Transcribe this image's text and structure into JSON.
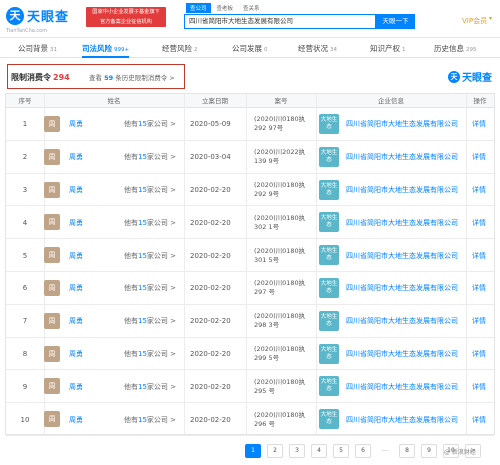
{
  "header": {
    "logo_mark": "天",
    "logo_name": "天眼查",
    "logo_sub": "TianYanCha.com",
    "badge_line1": "国家中小企业发展子基金旗下",
    "badge_line2": "官方备案企业征信机构",
    "search_tabs": [
      "查公司",
      "查老板",
      "查关系"
    ],
    "search_value": "四川省简阳市大地生态发展有限公司",
    "search_button": "天眼一下",
    "vip_label": "VIP会员",
    "accent_color": "#0084ff",
    "badge_color": "#e23b3b"
  },
  "nav": {
    "tabs": [
      {
        "label": "公司背景",
        "count": "31"
      },
      {
        "label": "司法风险",
        "count": "999+"
      },
      {
        "label": "经营风险",
        "count": "2"
      },
      {
        "label": "公司发展",
        "count": "0"
      },
      {
        "label": "经营状况",
        "count": "34"
      },
      {
        "label": "知识产权",
        "count": "1"
      },
      {
        "label": "历史信息",
        "count": "295"
      }
    ],
    "active_tab": "司法风险"
  },
  "section": {
    "title": "限制消费令",
    "count": "294",
    "history_text_prefix": "查看",
    "history_count": "59",
    "history_text_suffix": "条历史限制消费令 >",
    "watermark_mark": "天",
    "watermark_name": "天眼查"
  },
  "table": {
    "headers": [
      "序号",
      "姓名",
      "立案日期",
      "案号",
      "企业信息",
      "操作"
    ],
    "rows": [
      {
        "idx": "1",
        "avatar": "周",
        "name": "周勇",
        "own_prefix": "他有",
        "own_count": "15",
        "own_suffix": "家公司 >",
        "date": "2020-05-09",
        "case": "(2020)川0180执292 97号",
        "company_avatar": "大地生态",
        "company": "四川省简阳市大地生态发展有限公司",
        "action": "详情"
      },
      {
        "idx": "2",
        "avatar": "周",
        "name": "周勇",
        "own_prefix": "他有",
        "own_count": "15",
        "own_suffix": "家公司 >",
        "date": "2020-03-04",
        "case": "(2020)川2022执139 9号",
        "company_avatar": "大地生态",
        "company": "四川省简阳市大地生态发展有限公司",
        "action": "详情"
      },
      {
        "idx": "3",
        "avatar": "周",
        "name": "周勇",
        "own_prefix": "他有",
        "own_count": "15",
        "own_suffix": "家公司 >",
        "date": "2020-02-20",
        "case": "(2020)川0180执292 9号",
        "company_avatar": "大地生态",
        "company": "四川省简阳市大地生态发展有限公司",
        "action": "详情"
      },
      {
        "idx": "4",
        "avatar": "周",
        "name": "周勇",
        "own_prefix": "他有",
        "own_count": "15",
        "own_suffix": "家公司 >",
        "date": "2020-02-20",
        "case": "(2020)川0180执302 1号",
        "company_avatar": "大地生态",
        "company": "四川省简阳市大地生态发展有限公司",
        "action": "详情"
      },
      {
        "idx": "5",
        "avatar": "周",
        "name": "周勇",
        "own_prefix": "他有",
        "own_count": "15",
        "own_suffix": "家公司 >",
        "date": "2020-02-20",
        "case": "(2020)川0180执301 5号",
        "company_avatar": "大地生态",
        "company": "四川省简阳市大地生态发展有限公司",
        "action": "详情"
      },
      {
        "idx": "6",
        "avatar": "周",
        "name": "周勇",
        "own_prefix": "他有",
        "own_count": "15",
        "own_suffix": "家公司 >",
        "date": "2020-02-20",
        "case": "(2020)川0180执297 号",
        "company_avatar": "大地生态",
        "company": "四川省简阳市大地生态发展有限公司",
        "action": "详情"
      },
      {
        "idx": "7",
        "avatar": "周",
        "name": "周勇",
        "own_prefix": "他有",
        "own_count": "15",
        "own_suffix": "家公司 >",
        "date": "2020-02-20",
        "case": "(2020)川0180执298 3号",
        "company_avatar": "大地生态",
        "company": "四川省简阳市大地生态发展有限公司",
        "action": "详情"
      },
      {
        "idx": "8",
        "avatar": "周",
        "name": "周勇",
        "own_prefix": "他有",
        "own_count": "15",
        "own_suffix": "家公司 >",
        "date": "2020-02-20",
        "case": "(2020)川0180执299 5号",
        "company_avatar": "大地生态",
        "company": "四川省简阳市大地生态发展有限公司",
        "action": "详情"
      },
      {
        "idx": "9",
        "avatar": "周",
        "name": "周勇",
        "own_prefix": "他有",
        "own_count": "15",
        "own_suffix": "家公司 >",
        "date": "2020-02-20",
        "case": "(2020)川0180执295 号",
        "company_avatar": "大地生态",
        "company": "四川省简阳市大地生态发展有限公司",
        "action": "详情"
      },
      {
        "idx": "10",
        "avatar": "周",
        "name": "周勇",
        "own_prefix": "他有",
        "own_count": "15",
        "own_suffix": "家公司 >",
        "date": "2020-02-20",
        "case": "(2020)川0180执296 号",
        "company_avatar": "大地生态",
        "company": "四川省简阳市大地生态发展有限公司",
        "action": "详情"
      }
    ]
  },
  "pagination": {
    "pages": [
      "1",
      "2",
      "3",
      "4",
      "5",
      "6",
      "...",
      "8",
      "9",
      "10",
      ">"
    ],
    "current": "1"
  },
  "footer_watermark": "@ 新浪财经"
}
